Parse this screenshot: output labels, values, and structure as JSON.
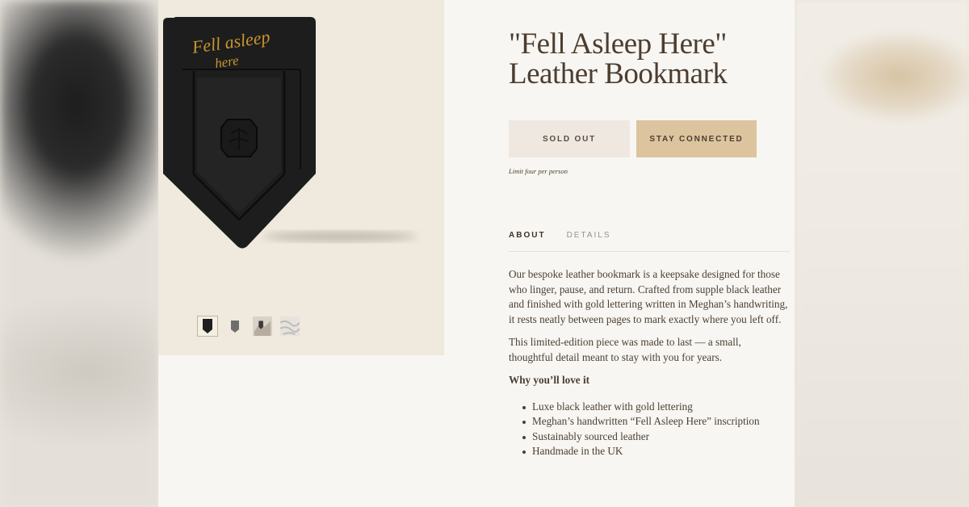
{
  "product": {
    "title": "\"Fell Asleep Here\" Leather Bookmark",
    "engraving": "Fell asleep here"
  },
  "actions": {
    "sold_out_label": "SOLD OUT",
    "stay_connected_label": "STAY CONNECTED",
    "limit_note": "Limit four per person"
  },
  "tabs": [
    {
      "label": "ABOUT",
      "active": true
    },
    {
      "label": "DETAILS",
      "active": false
    }
  ],
  "about": {
    "paragraph1": "Our bespoke leather bookmark is a keepsake designed for those who linger, pause, and return. Crafted from supple black leather and finished with gold lettering written in Meghan’s handwriting, it rests neatly between pages to mark exactly where you left off.",
    "paragraph2": "This limited-edition piece was made to last — a small, thoughtful detail meant to stay with you for years.",
    "why_heading": "Why you’ll love it",
    "bullets": [
      "Luxe black leather with gold lettering",
      "Meghan’s handwritten “Fell Asleep Here” inscription",
      "Sustainably sourced leather",
      "Handmade in the UK"
    ]
  },
  "gallery": {
    "thumbnails": [
      "black-bookmark-thumb",
      "grey-bookmark-thumb",
      "lifestyle-photo-thumb",
      "texture-photo-thumb"
    ],
    "active_index": 0
  },
  "colors": {
    "accent": "#dcc49e",
    "sold_out_bg": "#efe8e0",
    "gold_lettering": "#c9962e",
    "leather": "#1c1c1c"
  }
}
